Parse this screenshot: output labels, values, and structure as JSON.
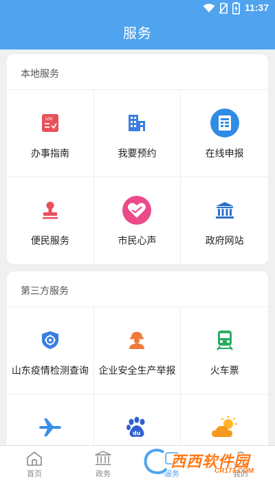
{
  "status_bar": {
    "time": "11:37"
  },
  "header": {
    "title": "服务"
  },
  "local_services": {
    "title": "本地服务",
    "items": [
      {
        "label": "办事指南",
        "icon": "clipboard-checklist-icon"
      },
      {
        "label": "我要预约",
        "icon": "building-icon"
      },
      {
        "label": "在线申报",
        "icon": "document-form-icon"
      },
      {
        "label": "便民服务",
        "icon": "stamp-icon"
      },
      {
        "label": "市民心声",
        "icon": "heart-icon"
      },
      {
        "label": "政府网站",
        "icon": "government-building-icon"
      }
    ]
  },
  "third_party_services": {
    "title": "第三方服务",
    "items": [
      {
        "label": "山东疫情检测查询",
        "icon": "shield-icon"
      },
      {
        "label": "企业安全生产举报",
        "icon": "worker-helmet-icon"
      },
      {
        "label": "火车票",
        "icon": "train-icon"
      },
      {
        "label": "",
        "icon": "airplane-icon"
      },
      {
        "label": "",
        "icon": "baidu-paw-icon"
      },
      {
        "label": "",
        "icon": "weather-sun-cloud-icon"
      }
    ]
  },
  "tab_bar": {
    "tabs": [
      {
        "label": "首页",
        "icon": "home-icon"
      },
      {
        "label": "政务",
        "icon": "government-building-icon"
      },
      {
        "label": "服务",
        "icon": "service-icon",
        "active": true
      },
      {
        "label": "我的",
        "icon": "user-icon"
      }
    ]
  },
  "watermark": {
    "text": "西西软件园",
    "sub": "CR173.COM"
  },
  "colors": {
    "primary": "#4fa3ef",
    "red_icon": "#e8505b",
    "blue_icon": "#3a7fe0",
    "green_icon": "#2bab62",
    "orange_icon": "#f07a3a"
  }
}
